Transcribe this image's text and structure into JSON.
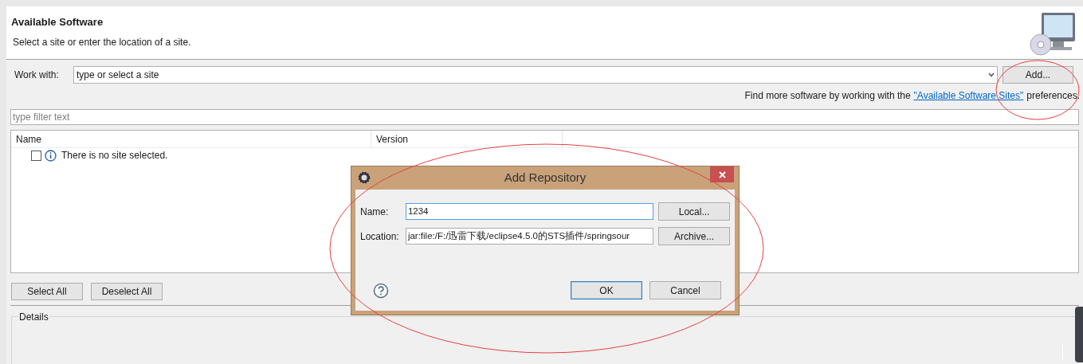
{
  "header": {
    "title": "Available Software",
    "subtitle": "Select a site or enter the location of a site."
  },
  "work_with": {
    "label": "Work with:",
    "placeholder": "type or select a site",
    "add_button": "Add..."
  },
  "hint": {
    "text": "Find more software by working with the",
    "link": "\"Available Software Sites\"",
    "suffix": "preferences."
  },
  "filter": {
    "placeholder": "type filter text"
  },
  "table": {
    "columns": [
      "Name",
      "Version"
    ],
    "rows": [
      {
        "name": "There is no site selected.",
        "checked": false
      }
    ]
  },
  "buttons": [
    "Select All",
    "Deselect All"
  ],
  "details": {
    "title": "Details"
  },
  "dialog": {
    "title": "Add Repository",
    "fields": [
      {
        "label": "Name:",
        "value": "1234",
        "focused": true,
        "button": "Local..."
      },
      {
        "label": "Location:",
        "value": "jar:file:/F:/迅雷下载/eclipse4.5.0的STS插件/springsour",
        "focused": false,
        "button": "Archive..."
      }
    ],
    "buttons": [
      {
        "label": "OK",
        "default": true
      },
      {
        "label": "Cancel",
        "default": false
      }
    ]
  }
}
